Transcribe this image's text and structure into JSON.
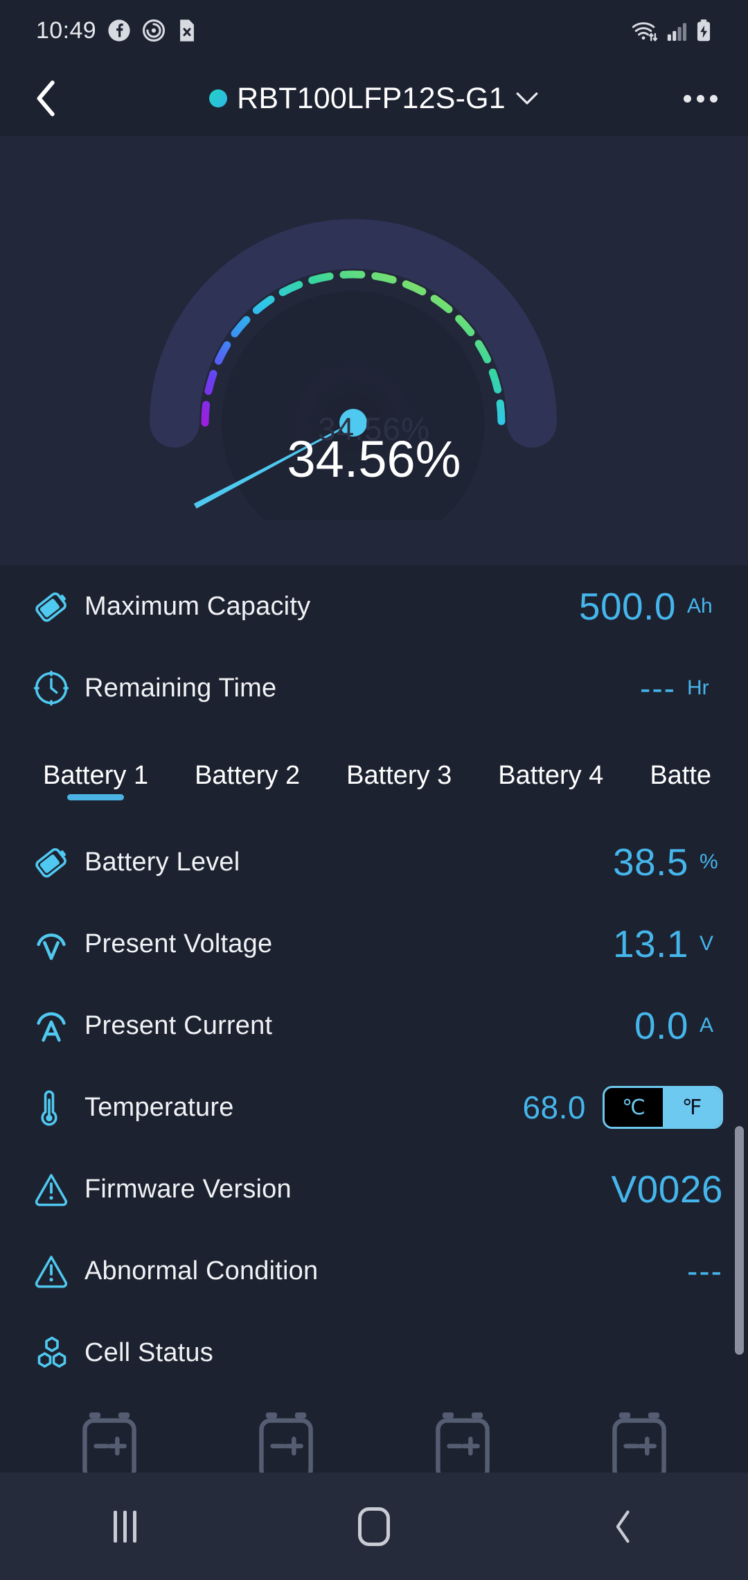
{
  "status_bar": {
    "time": "10:49",
    "left_icons": [
      "facebook-icon",
      "clock-alarm-icon",
      "sim-x-icon"
    ],
    "right_icons": [
      "wifi-icon",
      "signal-icon",
      "battery-charging-icon"
    ]
  },
  "header": {
    "back_icon": "chevron-left-icon",
    "device_name": "RBT100LFP12S-G1",
    "status_dot_color": "#26c9c8",
    "dropdown_icon": "chevron-down-icon",
    "overflow_icon": "more-horizontal-icon"
  },
  "gauge": {
    "value_text": "34.56%",
    "value_number": 34.56,
    "min": 0,
    "max": 100,
    "ghost_text": "34.56%",
    "needle_color": "#4fc9f0",
    "track_color": "#2f3356",
    "arc_colors": [
      "#9b1fe0",
      "#5d4bf0",
      "#3b8ef6",
      "#2fc8e8",
      "#36d6a0",
      "#7fe06a",
      "#d7e84a"
    ]
  },
  "summary_rows": [
    {
      "icon": "battery-tilt-icon",
      "label": "Maximum Capacity",
      "value": "500.0",
      "unit": "Ah",
      "is_dash": false
    },
    {
      "icon": "clock-icon",
      "label": "Remaining Time",
      "value": "---",
      "unit": "Hr",
      "is_dash": true
    }
  ],
  "tabs": {
    "items": [
      {
        "label": "Battery 1",
        "active": true
      },
      {
        "label": "Battery 2",
        "active": false
      },
      {
        "label": "Battery 3",
        "active": false
      },
      {
        "label": "Battery 4",
        "active": false
      },
      {
        "label": "Batte",
        "active": false
      }
    ]
  },
  "detail_rows": [
    {
      "icon": "battery-tilt-icon",
      "label": "Battery Level",
      "value": "38.5",
      "unit": "%",
      "is_dash": false,
      "has_toggle": false
    },
    {
      "icon": "voltage-v-icon",
      "label": "Present Voltage",
      "value": "13.1",
      "unit": "V",
      "is_dash": false,
      "has_toggle": false
    },
    {
      "icon": "current-a-icon",
      "label": "Present Current",
      "value": "0.0",
      "unit": "A",
      "is_dash": false,
      "has_toggle": false
    },
    {
      "icon": "thermometer-icon",
      "label": "Temperature",
      "value": "68.0",
      "unit": "",
      "is_dash": false,
      "has_toggle": true
    },
    {
      "icon": "warning-triangle-icon",
      "label": "Firmware Version",
      "value": "V0026",
      "unit": "",
      "is_dash": false,
      "has_toggle": false
    },
    {
      "icon": "warning-triangle-icon",
      "label": "Abnormal Condition",
      "value": "---",
      "unit": "",
      "is_dash": true,
      "has_toggle": false
    },
    {
      "icon": "cell-hex-icon",
      "label": "Cell Status",
      "value": "",
      "unit": "",
      "is_dash": false,
      "has_toggle": false
    }
  ],
  "temp_toggle": {
    "celsius_label": "℃",
    "fahrenheit_label": "℉",
    "selected": "℉"
  },
  "cell_icons": {
    "count": 4,
    "icon": "battery-cell-icon"
  },
  "nav_bar": {
    "recents_icon": "recents-icon",
    "home_icon": "home-icon",
    "back_icon": "nav-back-icon"
  }
}
